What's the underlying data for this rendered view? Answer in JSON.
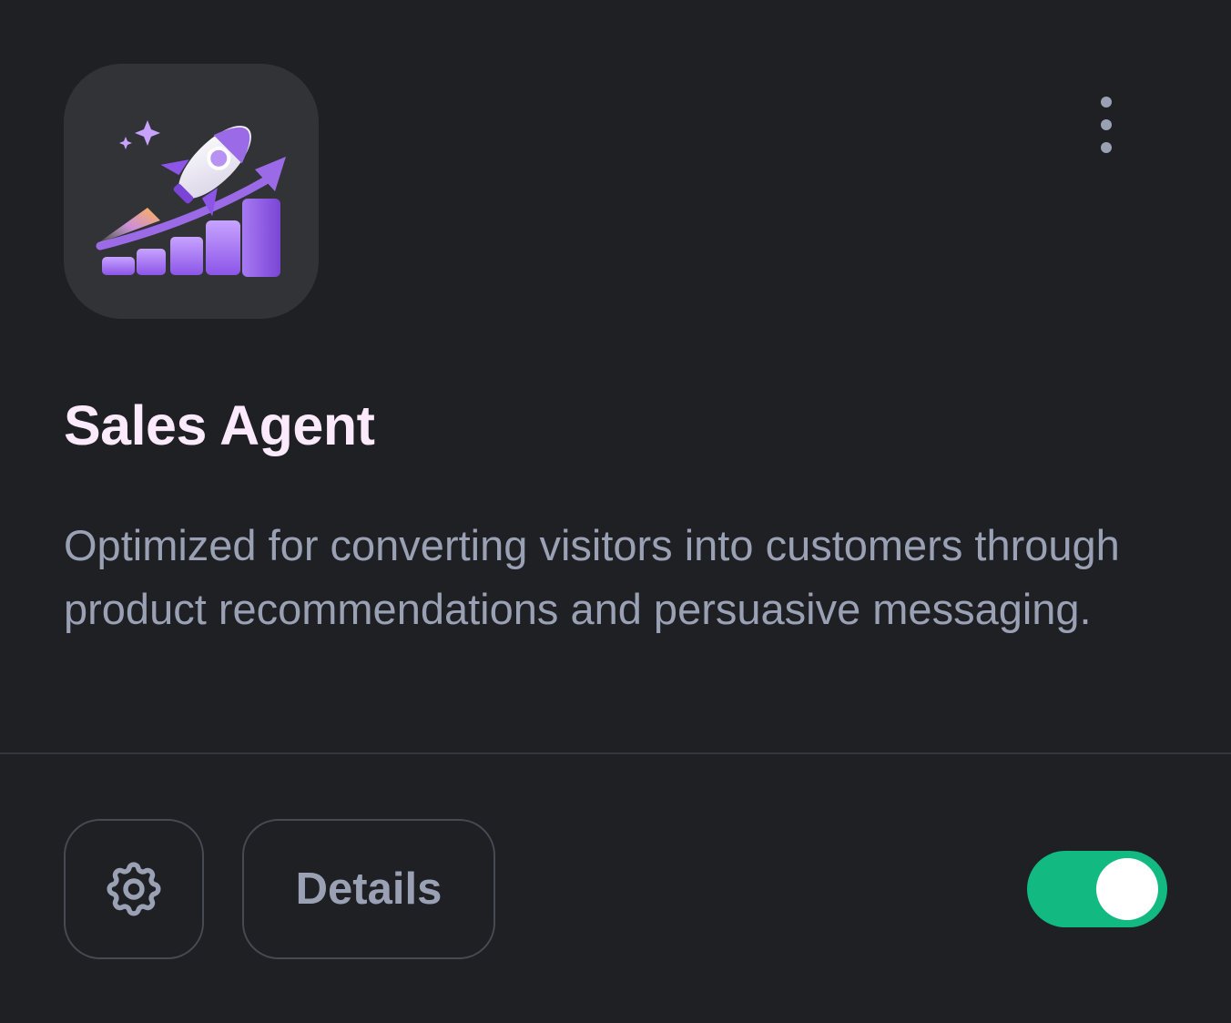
{
  "agent": {
    "name": "Sales Agent",
    "description": "Optimized for converting visitors into customers through product recommendations and persuasive messaging.",
    "icon": "rocket-growth-chart-icon",
    "enabled": true
  },
  "menu": {
    "icon": "more-vertical-icon"
  },
  "footer": {
    "settings_icon": "gear-icon",
    "details_label": "Details",
    "toggle_state": "on"
  },
  "colors": {
    "background": "#1f2023",
    "tile": "#323336",
    "title": "#fbeafb",
    "muted_text": "#9aa1b4",
    "border": "#474a50",
    "toggle_on": "#12b981",
    "accent_purple": "#9b6ae6"
  }
}
